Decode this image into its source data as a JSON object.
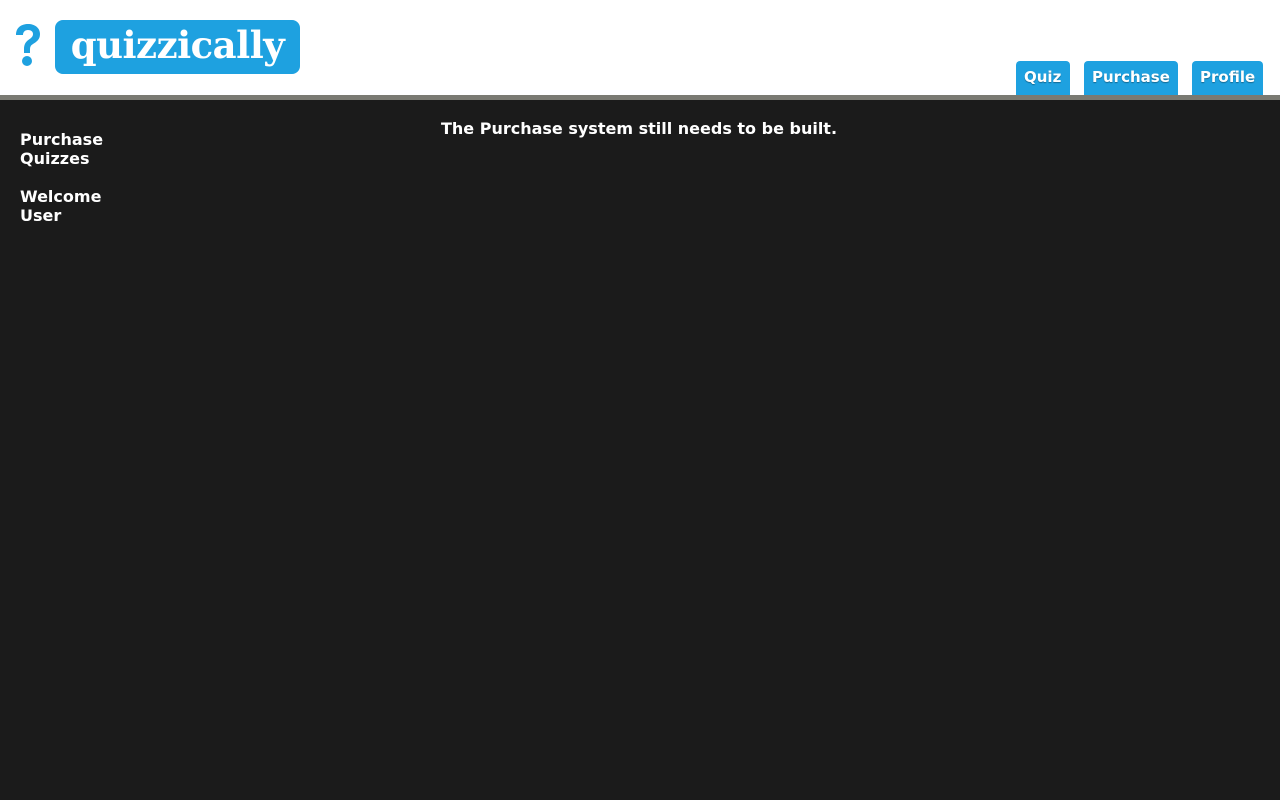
{
  "brand": {
    "name": "quizzically",
    "color": "#1ea1e0"
  },
  "nav": {
    "tabs": [
      {
        "label": "Quiz"
      },
      {
        "label": "Purchase"
      },
      {
        "label": "Profile"
      }
    ]
  },
  "sidebar": {
    "items": [
      {
        "label": "Purchase Quizzes"
      },
      {
        "label": "Welcome User"
      }
    ]
  },
  "main": {
    "message": "The Purchase system still needs to be built."
  },
  "icons": {
    "logo_mark": "question-mark-icon"
  },
  "colors": {
    "background": "#1b1b1b",
    "header": "#ffffff",
    "header_rule": "#7a7a72",
    "accent": "#1ea1e0"
  }
}
